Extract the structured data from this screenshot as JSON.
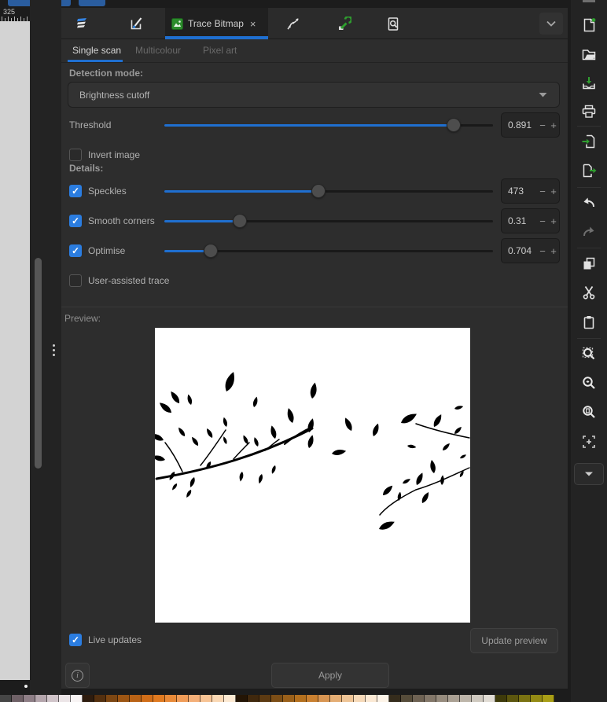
{
  "canvas": {
    "ruler_label": "325"
  },
  "dialog": {
    "tabs": {
      "trace": {
        "label": "Trace Bitmap",
        "close_glyph": "×"
      },
      "icon_names": [
        "layers-icon",
        "pen-square-icon",
        "trace-bitmap-image-icon",
        "path-effects-icon",
        "wrench-icon",
        "find-document-icon",
        "chevron-down-icon"
      ]
    },
    "subtabs": [
      {
        "label": "Single scan",
        "active": true
      },
      {
        "label": "Multicolour",
        "active": false
      },
      {
        "label": "Pixel art",
        "active": false
      }
    ],
    "detection": {
      "label": "Detection mode:",
      "value": "Brightness cutoff"
    },
    "threshold": {
      "label": "Threshold",
      "value": "0.891",
      "fraction": 0.88,
      "checkable": false
    },
    "invert_image": {
      "label": "Invert image",
      "checked": false
    },
    "details_label": "Details:",
    "sliders": [
      {
        "label": "Speckles",
        "checked": true,
        "value": "473",
        "fraction": 0.47
      },
      {
        "label": "Smooth corners",
        "checked": true,
        "value": "0.31",
        "fraction": 0.23
      },
      {
        "label": "Optimise",
        "checked": true,
        "value": "0.704",
        "fraction": 0.14
      }
    ],
    "user_assisted": {
      "label": "User-assisted trace",
      "checked": false
    },
    "preview_label": "Preview:",
    "live_updates": {
      "label": "Live updates",
      "checked": true
    },
    "update_preview_label": "Update preview",
    "apply_label": "Apply",
    "info_glyph": "i",
    "spin_minus": "−",
    "spin_plus": "+"
  },
  "right_toolbar": {
    "items": [
      "new-document",
      "open-document",
      "save-document",
      "print",
      "import",
      "export",
      "undo",
      "redo",
      "duplicate",
      "cut",
      "paste",
      "zoom-selection",
      "zoom-drawing",
      "zoom-page",
      "zoom-center-page",
      "toolbar-overflow"
    ]
  },
  "colors": {
    "accent_blue": "#1f6fd0",
    "checkbox_blue": "#2b7de0",
    "icon_green": "#2f9e2f",
    "panel_bg": "#2d2d2d"
  },
  "palette_colors": [
    "#454545",
    "#6e6066",
    "#8e7e86",
    "#b4a5ac",
    "#d0c4c9",
    "#ece5e7",
    "#f8f4f4",
    "#2e1c0e",
    "#54300f",
    "#7c4612",
    "#9c5513",
    "#b96215",
    "#d06d18",
    "#e07a20",
    "#e98a38",
    "#f09c58",
    "#f4af78",
    "#f7c394",
    "#fad8b4",
    "#fce9d2",
    "#241505",
    "#40280d",
    "#5c3a12",
    "#7c4e16",
    "#9a601a",
    "#b4701e",
    "#c98030",
    "#d89552",
    "#e4ad74",
    "#eec496",
    "#f6d9b8",
    "#fbe9d4",
    "#fdf4e8",
    "#352c1c",
    "#564c3a",
    "#6e6253",
    "#837769",
    "#968b7d",
    "#aaa093",
    "#bdb5a9",
    "#cfc9bf",
    "#e1dcd4",
    "#3e3a0a",
    "#5c560e",
    "#7a7212",
    "#938a14",
    "#a89e16"
  ],
  "preview_image": {
    "description": "black silhouette of leafy branches on white background",
    "background": "#ffffff",
    "ink": "#000000",
    "stems": [
      [
        "M2 192 C70 180 135 162 200 128",
        3
      ],
      [
        "M58 175 C70 160 80 145 90 130",
        1.5
      ],
      [
        "M100 167 C108 158 114 152 120 146",
        1.5
      ],
      [
        "M140 156 C148 150 152 146 158 142",
        1.5
      ],
      [
        "M35 183 C28 168 20 155 13 146",
        1.5
      ],
      [
        "M165 148 C175 140 185 133 198 127",
        2
      ],
      [
        "M400 140 C375 135 355 130 332 122",
        1.5
      ],
      [
        "M400 178 C378 188 358 198 332 206",
        1.5
      ],
      [
        "M332 206 C312 216 296 226 286 238",
        1.5
      ]
    ],
    "leaves": [
      [
        31,
        96,
        -35,
        0.8
      ],
      [
        46,
        98,
        -15,
        0.6
      ],
      [
        91,
        81,
        20,
        1.15
      ],
      [
        126,
        101,
        15,
        0.6
      ],
      [
        21,
        108,
        -50,
        0.85
      ],
      [
        200,
        90,
        10,
        0.9
      ],
      [
        175,
        121,
        -15,
        0.85
      ],
      [
        196,
        133,
        15,
        0.8
      ],
      [
        91,
        126,
        -15,
        0.55
      ],
      [
        38,
        138,
        -35,
        0.6
      ],
      [
        11,
        143,
        -65,
        0.8
      ],
      [
        55,
        150,
        -35,
        0.6
      ],
      [
        73,
        140,
        -30,
        0.6
      ],
      [
        91,
        148,
        -20,
        0.45
      ],
      [
        118,
        148,
        -25,
        0.55
      ],
      [
        131,
        151,
        -20,
        0.55
      ],
      [
        153,
        141,
        -15,
        0.75
      ],
      [
        196,
        153,
        15,
        0.75
      ],
      [
        225,
        160,
        80,
        0.8
      ],
      [
        13,
        168,
        -75,
        0.75
      ],
      [
        25,
        183,
        -150,
        0.55
      ],
      [
        50,
        190,
        -160,
        0.6
      ],
      [
        71,
        170,
        -150,
        0.5
      ],
      [
        111,
        183,
        -170,
        0.55
      ],
      [
        136,
        186,
        -165,
        0.55
      ],
      [
        153,
        175,
        -160,
        0.5
      ],
      [
        28,
        198,
        -145,
        0.45
      ],
      [
        46,
        206,
        -150,
        0.5
      ],
      [
        250,
        131,
        -25,
        0.8
      ],
      [
        278,
        138,
        20,
        0.75
      ],
      [
        313,
        121,
        60,
        1.0
      ],
      [
        355,
        126,
        30,
        0.8
      ],
      [
        381,
        103,
        75,
        0.5
      ],
      [
        381,
        135,
        45,
        0.55
      ],
      [
        321,
        150,
        100,
        0.5
      ],
      [
        366,
        156,
        45,
        0.55
      ],
      [
        388,
        166,
        60,
        0.4
      ],
      [
        355,
        185,
        -10,
        0.75
      ],
      [
        388,
        190,
        30,
        0.4
      ],
      [
        365,
        200,
        5,
        0.55
      ],
      [
        333,
        200,
        25,
        0.75
      ],
      [
        315,
        198,
        60,
        0.5
      ],
      [
        290,
        213,
        45,
        0.75
      ],
      [
        310,
        220,
        10,
        0.5
      ],
      [
        340,
        223,
        30,
        0.7
      ],
      [
        285,
        256,
        65,
        0.95
      ]
    ]
  }
}
